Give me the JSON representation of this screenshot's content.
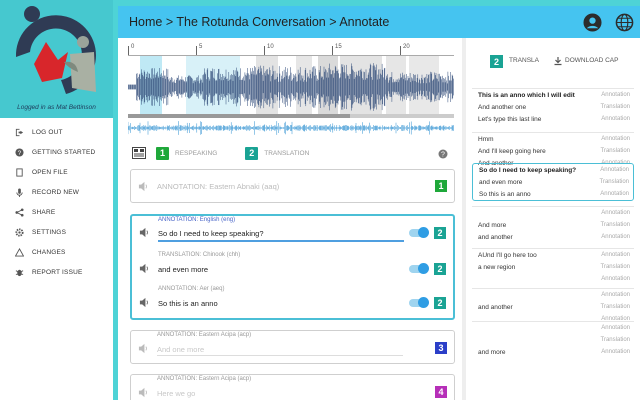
{
  "sidebar": {
    "logged_in_prefix": "Logged in as",
    "user": "Mat Bettinson",
    "menu": [
      {
        "label": "LOG OUT",
        "icon": "logout-icon"
      },
      {
        "label": "GETTING STARTED",
        "icon": "help-circle-icon"
      },
      {
        "label": "OPEN FILE",
        "icon": "folder-icon"
      },
      {
        "label": "RECORD NEW",
        "icon": "microphone-icon"
      },
      {
        "label": "SHARE",
        "icon": "share-icon"
      },
      {
        "label": "SETTINGS",
        "icon": "gear-icon"
      },
      {
        "label": "CHANGES",
        "icon": "triangle-icon"
      },
      {
        "label": "REPORT ISSUE",
        "icon": "bug-icon"
      }
    ]
  },
  "header": {
    "breadcrumb": "Home > The Rotunda Conversation > Annotate"
  },
  "timeline": {
    "ticks": [
      "0",
      "5",
      "10",
      "15",
      "20"
    ]
  },
  "tabs": {
    "respeaking": {
      "number": "1",
      "label": "RESPEAKING",
      "color": "#1fa83a"
    },
    "translation": {
      "number": "2",
      "label": "TRANSLATION",
      "color": "#1aa394"
    }
  },
  "cards": [
    {
      "rows": [
        {
          "label": "",
          "text": "ANNOTATION: Eastern Abnaki (aaq)",
          "placeholder": true,
          "badge": "1",
          "badge_color": "#1fa83a",
          "toggle": false
        }
      ]
    },
    {
      "active": true,
      "rows": [
        {
          "label": "ANNOTATION: English (eng)",
          "text": "So do I need to keep speaking?",
          "badge": "2",
          "badge_color": "#1aa394",
          "toggle": true
        },
        {
          "label": "TRANSLATION: Chinook (chh)",
          "text": "and even more",
          "badge": "2",
          "badge_color": "#1aa394",
          "toggle": true
        },
        {
          "label": "ANNOTATION: Aer (aeq)",
          "text": "So this is an anno",
          "badge": "2",
          "badge_color": "#1aa394",
          "toggle": true
        }
      ]
    },
    {
      "rows": [
        {
          "label": "ANNOTATION: Eastern Acipa (acp)",
          "text": "And one more",
          "placeholder": true,
          "badge": "3",
          "badge_color": "#2b3fc8",
          "toggle": false
        }
      ]
    },
    {
      "rows": [
        {
          "label": "ANNOTATION: Eastern Acipa (acp)",
          "text": "Here we go",
          "placeholder": true,
          "badge": "4",
          "badge_color": "#b62fb8",
          "toggle": false
        }
      ]
    }
  ],
  "right_panel": {
    "tab_number": "2",
    "tab_label": "TRANSLA",
    "download_label": "DOWNLOAD CAP",
    "groups": [
      {
        "items": [
          {
            "text": "This is an anno which I will edit",
            "kind": "Annotation",
            "bold": true
          },
          {
            "text": "And another one",
            "kind": "Translation"
          },
          {
            "text": "Let's type this last line",
            "kind": "Annotation"
          }
        ]
      },
      {
        "items": [
          {
            "text": "Hmm",
            "kind": "Annotation"
          },
          {
            "text": "And I'll keep going here",
            "kind": "Translation"
          },
          {
            "text": "And another",
            "kind": "Annotation"
          }
        ]
      },
      {
        "selected": true,
        "items": [
          {
            "text": "So do I need to keep speaking?",
            "kind": "Annotation",
            "bold": true
          },
          {
            "text": "and even more",
            "kind": "Translation"
          },
          {
            "text": "So this is an anno",
            "kind": "Annotation"
          }
        ]
      },
      {
        "items": [
          {
            "text": "",
            "kind": "Annotation"
          },
          {
            "text": "And more",
            "kind": "Translation"
          },
          {
            "text": "and another",
            "kind": "Annotation"
          }
        ]
      },
      {
        "items": [
          {
            "text": "AUnd I'll go here too",
            "kind": "Annotation"
          },
          {
            "text": "a new region",
            "kind": "Translation"
          },
          {
            "text": "",
            "kind": "Annotation"
          }
        ]
      },
      {
        "items": [
          {
            "text": "",
            "kind": "Annotation"
          },
          {
            "text": "and another",
            "kind": "Translation"
          },
          {
            "text": "",
            "kind": "Annotation"
          }
        ]
      },
      {
        "items": [
          {
            "text": "",
            "kind": "Annotation"
          },
          {
            "text": "",
            "kind": "Translation"
          },
          {
            "text": "and more",
            "kind": "Annotation"
          }
        ]
      }
    ]
  }
}
